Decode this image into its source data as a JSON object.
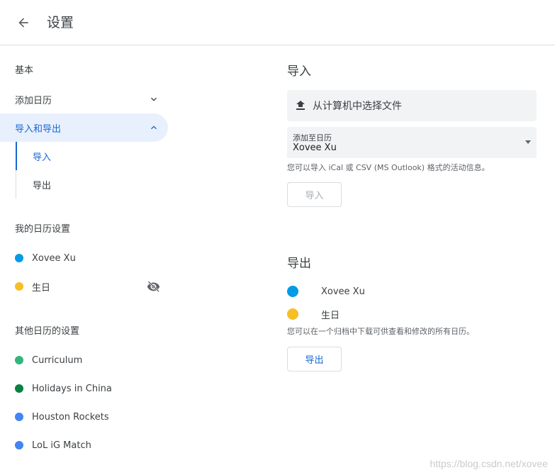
{
  "header": {
    "title": "设置",
    "back_icon": "arrow-left-icon"
  },
  "sidebar": {
    "basic_label": "基本",
    "add_calendar": "添加日历",
    "import_export": "导入和导出",
    "sub_items": [
      "导入",
      "导出"
    ],
    "my_calendars_label": "我的日历设置",
    "my_calendars": [
      {
        "name": "Xovee Xu",
        "color": "#039be5"
      },
      {
        "name": "生日",
        "color": "#f6bf26",
        "hidden": true
      }
    ],
    "other_calendars_label": "其他日历的设置",
    "other_calendars": [
      {
        "name": "Curriculum",
        "color": "#33b679"
      },
      {
        "name": "Holidays in China",
        "color": "#0b8043"
      },
      {
        "name": "Houston Rockets",
        "color": "#4285f4"
      },
      {
        "name": "LoL iG Match",
        "color": "#4285f4"
      }
    ]
  },
  "import_section": {
    "title": "导入",
    "file_button": "从计算机中选择文件",
    "select_label": "添加至日历",
    "select_value": "Xovee Xu",
    "hint": "您可以导入 iCal 或 CSV (MS Outlook) 格式的活动信息。",
    "import_button": "导入"
  },
  "export_section": {
    "title": "导出",
    "calendars": [
      {
        "name": "Xovee Xu",
        "color": "#039be5"
      },
      {
        "name": "生日",
        "color": "#f6bf26"
      }
    ],
    "hint": "您可以在一个归档中下载可供查看和修改的所有日历。",
    "export_button": "导出"
  },
  "watermark": "https://blog.csdn.net/xovee",
  "colors": {
    "accent": "#1967d2",
    "active_bg": "#e8f0fe"
  }
}
